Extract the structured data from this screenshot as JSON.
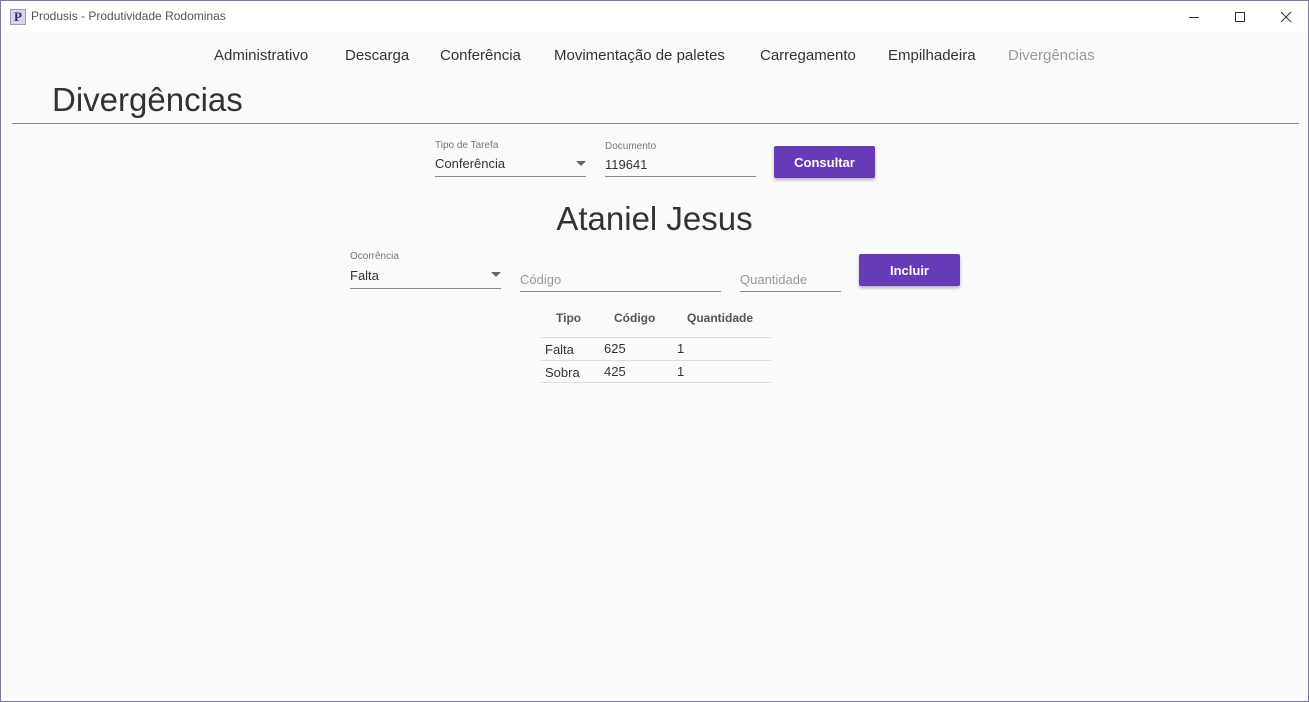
{
  "window": {
    "title": "Produsis - Produtividade Rodominas",
    "app_icon_letter": "P"
  },
  "nav": {
    "items": [
      {
        "label": "Administrativo"
      },
      {
        "label": "Descarga"
      },
      {
        "label": "Conferência"
      },
      {
        "label": "Movimentação de paletes"
      },
      {
        "label": "Carregamento"
      },
      {
        "label": "Empilhadeira"
      },
      {
        "label": "Divergências",
        "active": true
      }
    ]
  },
  "page": {
    "title": "Divergências"
  },
  "search": {
    "task_type_label": "Tipo de Tarefa",
    "task_type_value": "Conferência",
    "document_label": "Documento",
    "document_value": "119641",
    "consult_label": "Consultar"
  },
  "person": {
    "name": "Ataniel Jesus"
  },
  "entry": {
    "occurrence_label": "Ocorrência",
    "occurrence_value": "Falta",
    "code_placeholder": "Código",
    "quantity_placeholder": "Quantidade",
    "include_label": "Incluir"
  },
  "table": {
    "headers": [
      "Tipo",
      "Código",
      "Quantidade"
    ],
    "rows": [
      [
        "Falta",
        "625",
        "1"
      ],
      [
        "Sobra",
        "425",
        "1"
      ]
    ]
  },
  "colors": {
    "accent": "#673ab7",
    "background": "#fafafa"
  }
}
